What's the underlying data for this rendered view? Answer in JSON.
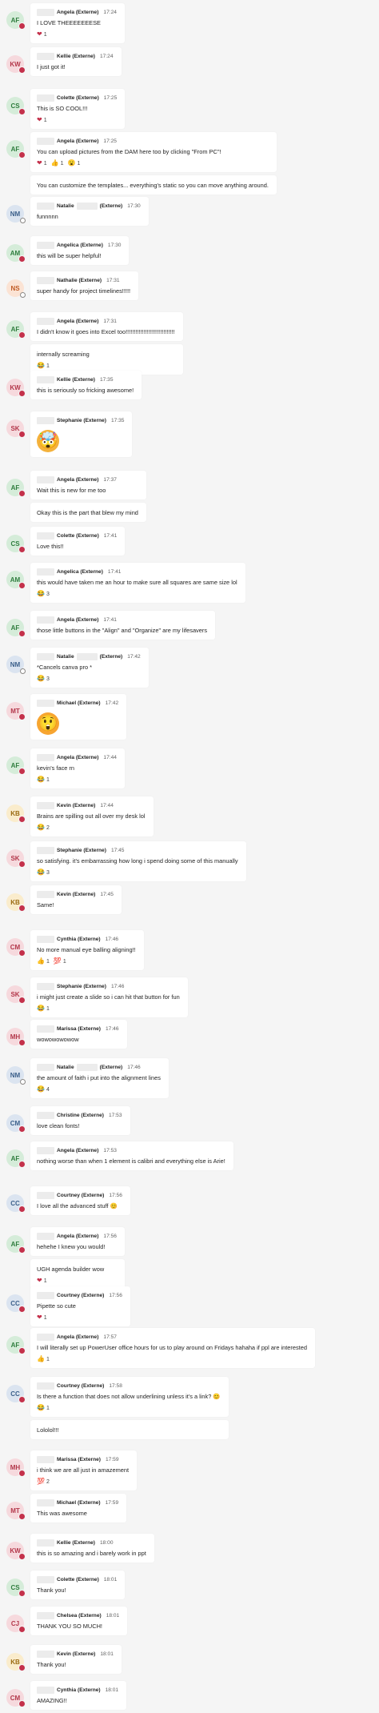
{
  "messages": [
    {
      "initials": "AF",
      "avatar_bg": "#d5ecd9",
      "avatar_fg": "#2f7d3e",
      "presence": "busy",
      "name_prefix_hidden": true,
      "name": "Angela (Externe)",
      "time": "17:24",
      "parts": [
        {
          "text": "I LOVE THEEEEEEESE",
          "reactions": [
            {
              "emoji": "❤",
              "color": "#c4314b",
              "count": "1"
            }
          ]
        }
      ]
    },
    {
      "initials": "KW",
      "avatar_bg": "#f6d9dd",
      "avatar_fg": "#b3374a",
      "presence": "busy",
      "name": "Kellie (Externe)",
      "time": "17:24",
      "parts": [
        {
          "text": "I just got it!",
          "reactions": []
        }
      ]
    },
    {
      "initials": "CS",
      "avatar_bg": "#d5ecd9",
      "avatar_fg": "#2f7d3e",
      "presence": "busy",
      "name": "Colette (Externe)",
      "time": "17:25",
      "parts": [
        {
          "text": "This is SO COOL!!!",
          "reactions": [
            {
              "emoji": "❤",
              "color": "#c4314b",
              "count": "1"
            }
          ]
        }
      ]
    },
    {
      "initials": "AF",
      "avatar_bg": "#d5ecd9",
      "avatar_fg": "#2f7d3e",
      "presence": "busy",
      "name": "Angela (Externe)",
      "time": "17:25",
      "parts": [
        {
          "text": "You can upload pictures from the DAM here too by clicking \"From PC\"!",
          "reactions": [
            {
              "emoji": "❤",
              "color": "#c4314b",
              "count": "1"
            },
            {
              "emoji": "👍",
              "color": "#e8a33a",
              "count": "1"
            },
            {
              "emoji": "😮",
              "color": "#e8a33a",
              "count": "1"
            }
          ]
        },
        {
          "text": "You can customize the templates... everything's static so you can move anything around.",
          "reactions": []
        }
      ]
    },
    {
      "initials": "NM",
      "avatar_bg": "#dbe4f0",
      "avatar_fg": "#3b5f8a",
      "presence": "away",
      "name": "Natalie",
      "name_mid_hidden": true,
      "name_suffix": "(Externe)",
      "time": "17:30",
      "parts": [
        {
          "text": "funnnnn",
          "reactions": []
        }
      ]
    },
    {
      "initials": "AM",
      "avatar_bg": "#d5ecd9",
      "avatar_fg": "#2f7d3e",
      "presence": "busy",
      "name": "Angelica (Externe)",
      "time": "17:30",
      "parts": [
        {
          "text": "this will be super helpful!",
          "reactions": []
        }
      ]
    },
    {
      "initials": "NS",
      "avatar_bg": "#fbe3d4",
      "avatar_fg": "#c05a23",
      "presence": "away",
      "name": "Nathalie (Externe)",
      "time": "17:31",
      "parts": [
        {
          "text": "super handy for project timelines!!!!!",
          "reactions": []
        }
      ]
    },
    {
      "initials": "AF",
      "avatar_bg": "#d5ecd9",
      "avatar_fg": "#2f7d3e",
      "presence": "busy",
      "name": "Angela (Externe)",
      "time": "17:31",
      "parts": [
        {
          "text": "I didn't know it goes into Excel too!!!!!!!!!!!!!!!!!!!!!!!!!!!!!!",
          "reactions": []
        },
        {
          "text": "internally screaming",
          "reactions": [
            {
              "emoji": "😂",
              "color": "#e8a33a",
              "count": "1"
            }
          ]
        }
      ]
    },
    {
      "initials": "KW",
      "avatar_bg": "#f6d9dd",
      "avatar_fg": "#b3374a",
      "presence": "busy",
      "name": "Kellie (Externe)",
      "time": "17:35",
      "parts": [
        {
          "text": "this is seriously so fricking awesome!",
          "reactions": []
        }
      ]
    },
    {
      "initials": "SK",
      "avatar_bg": "#f6d9dd",
      "avatar_fg": "#b3374a",
      "presence": "busy",
      "name": "Stephanie (Externe)",
      "time": "17:35",
      "parts": [
        {
          "sticker": "🤯",
          "sticker_style": "mind-blown",
          "reactions": []
        }
      ]
    },
    {
      "initials": "AF",
      "avatar_bg": "#d5ecd9",
      "avatar_fg": "#2f7d3e",
      "presence": "busy",
      "name": "Angela (Externe)",
      "time": "17:37",
      "parts": [
        {
          "text": "Wait this is new for me too",
          "reactions": []
        },
        {
          "text": "Okay this is the part that blew my mind",
          "reactions": []
        }
      ]
    },
    {
      "initials": "CS",
      "avatar_bg": "#d5ecd9",
      "avatar_fg": "#2f7d3e",
      "presence": "busy",
      "name": "Colette (Externe)",
      "time": "17:41",
      "parts": [
        {
          "text": "Love this!!",
          "reactions": []
        }
      ]
    },
    {
      "initials": "AM",
      "avatar_bg": "#d5ecd9",
      "avatar_fg": "#2f7d3e",
      "presence": "busy",
      "name": "Angelica (Externe)",
      "time": "17:41",
      "parts": [
        {
          "text": "this would have taken me an hour to make sure all squares are same size lol",
          "reactions": [
            {
              "emoji": "😂",
              "color": "#e8a33a",
              "count": "3"
            }
          ]
        }
      ]
    },
    {
      "initials": "AF",
      "avatar_bg": "#d5ecd9",
      "avatar_fg": "#2f7d3e",
      "presence": "busy",
      "name": "Angela (Externe)",
      "time": "17:41",
      "parts": [
        {
          "text": "those little buttons in the \"Align\" and \"Organize\" are my lifesavers",
          "reactions": []
        }
      ]
    },
    {
      "initials": "NM",
      "avatar_bg": "#dbe4f0",
      "avatar_fg": "#3b5f8a",
      "presence": "away",
      "name": "Natalie",
      "name_mid_hidden": true,
      "name_suffix": "(Externe)",
      "time": "17:42",
      "parts": [
        {
          "text": "*Cancels canva pro *",
          "reactions": [
            {
              "emoji": "😂",
              "color": "#e8a33a",
              "count": "3"
            }
          ]
        }
      ]
    },
    {
      "initials": "MT",
      "avatar_bg": "#f6d9dd",
      "avatar_fg": "#b3374a",
      "presence": "busy",
      "name": "Michael (Externe)",
      "time": "17:42",
      "parts": [
        {
          "sticker": "😲",
          "sticker_style": "shock",
          "reactions": []
        }
      ]
    },
    {
      "initials": "AF",
      "avatar_bg": "#d5ecd9",
      "avatar_fg": "#2f7d3e",
      "presence": "busy",
      "name": "Angela (Externe)",
      "time": "17:44",
      "parts": [
        {
          "text": "kevin's face rn",
          "reactions": [
            {
              "emoji": "😂",
              "color": "#e8a33a",
              "count": "1"
            }
          ]
        }
      ]
    },
    {
      "initials": "KB",
      "avatar_bg": "#faeccc",
      "avatar_fg": "#9a6a12",
      "presence": "busy",
      "name": "Kevin (Externe)",
      "time": "17:44",
      "parts": [
        {
          "text": "Brains are spilling out all over my desk lol",
          "reactions": [
            {
              "emoji": "😂",
              "color": "#e8a33a",
              "count": "2"
            }
          ]
        }
      ]
    },
    {
      "initials": "SK",
      "avatar_bg": "#f6d9dd",
      "avatar_fg": "#b3374a",
      "presence": "busy",
      "name": "Stephanie (Externe)",
      "time": "17:45",
      "parts": [
        {
          "text": "so satisfying. it's embarrassing how long i spend doing some of this manually",
          "reactions": [
            {
              "emoji": "😂",
              "color": "#e8a33a",
              "count": "3"
            }
          ]
        }
      ]
    },
    {
      "initials": "KB",
      "avatar_bg": "#faeccc",
      "avatar_fg": "#9a6a12",
      "presence": "busy",
      "name": "Kevin (Externe)",
      "time": "17:45",
      "parts": [
        {
          "text": "Same!",
          "reactions": []
        }
      ]
    },
    {
      "initials": "CM",
      "avatar_bg": "#f6d9dd",
      "avatar_fg": "#b3374a",
      "presence": "busy",
      "name": "Cynthia (Externe)",
      "time": "17:46",
      "parts": [
        {
          "text": "No more manual eye balling aligning!!",
          "reactions": [
            {
              "emoji": "👍",
              "color": "#e8a33a",
              "count": "1"
            },
            {
              "emoji": "💯",
              "color": "#c4314b",
              "count": "1"
            }
          ]
        }
      ]
    },
    {
      "initials": "SK",
      "avatar_bg": "#f6d9dd",
      "avatar_fg": "#b3374a",
      "presence": "busy",
      "name": "Stephanie (Externe)",
      "time": "17:46",
      "parts": [
        {
          "text": "i might just create a slide so i can hit that button for fun",
          "reactions": [
            {
              "emoji": "😂",
              "color": "#e8a33a",
              "count": "1"
            }
          ]
        }
      ]
    },
    {
      "initials": "MH",
      "avatar_bg": "#f6d9dd",
      "avatar_fg": "#b3374a",
      "presence": "busy",
      "name": "Marissa (Externe)",
      "time": "17:46",
      "parts": [
        {
          "text": "wowowowowow",
          "reactions": []
        }
      ]
    },
    {
      "initials": "NM",
      "avatar_bg": "#dbe4f0",
      "avatar_fg": "#3b5f8a",
      "presence": "away",
      "name": "Natalie",
      "name_mid_hidden": true,
      "name_suffix": "(Externe)",
      "time": "17:46",
      "parts": [
        {
          "text": "the amount of faith i put into the alignment lines",
          "reactions": [
            {
              "emoji": "😂",
              "color": "#e8a33a",
              "count": "4"
            }
          ]
        }
      ]
    },
    {
      "initials": "CM",
      "avatar_bg": "#dbe4f0",
      "avatar_fg": "#3b5f8a",
      "presence": "busy",
      "name": "Christine (Externe)",
      "time": "17:53",
      "parts": [
        {
          "text": "love clean fonts!",
          "reactions": []
        }
      ]
    },
    {
      "initials": "AF",
      "avatar_bg": "#d5ecd9",
      "avatar_fg": "#2f7d3e",
      "presence": "busy",
      "name": "Angela (Externe)",
      "time": "17:53",
      "parts": [
        {
          "text": "nothing worse than when 1 element is calibri and everything else is Arie!",
          "reactions": []
        }
      ]
    },
    {
      "initials": "CC",
      "avatar_bg": "#dbe4f0",
      "avatar_fg": "#3b5f8a",
      "presence": "busy",
      "name": "Courtney (Externe)",
      "time": "17:56",
      "parts": [
        {
          "text": "I love all the advanced stuff 😊",
          "reactions": []
        }
      ]
    },
    {
      "initials": "AF",
      "avatar_bg": "#d5ecd9",
      "avatar_fg": "#2f7d3e",
      "presence": "busy",
      "name": "Angela (Externe)",
      "time": "17:56",
      "parts": [
        {
          "text": "hehehe I knew you would!",
          "reactions": []
        },
        {
          "text": "UGH agenda builder wow",
          "reactions": [
            {
              "emoji": "❤",
              "color": "#c4314b",
              "count": "1"
            }
          ]
        }
      ]
    },
    {
      "initials": "CC",
      "avatar_bg": "#dbe4f0",
      "avatar_fg": "#3b5f8a",
      "presence": "busy",
      "name": "Courtney (Externe)",
      "time": "17:56",
      "parts": [
        {
          "text": "Pipette so cute",
          "reactions": [
            {
              "emoji": "❤",
              "color": "#c4314b",
              "count": "1"
            }
          ]
        }
      ]
    },
    {
      "initials": "AF",
      "avatar_bg": "#d5ecd9",
      "avatar_fg": "#2f7d3e",
      "presence": "busy",
      "name": "Angela (Externe)",
      "time": "17:57",
      "parts": [
        {
          "text": "I will literally set up PowerUser office hours for us to play around on Fridays hahaha if ppl are interested",
          "reactions": [
            {
              "emoji": "👍",
              "color": "#e8a33a",
              "count": "1"
            }
          ]
        }
      ]
    },
    {
      "initials": "CC",
      "avatar_bg": "#dbe4f0",
      "avatar_fg": "#3b5f8a",
      "presence": "busy",
      "name": "Courtney (Externe)",
      "time": "17:58",
      "parts": [
        {
          "text": "Is there a function that does not allow underlining unless it's a link? 😊",
          "reactions": [
            {
              "emoji": "😂",
              "color": "#e8a33a",
              "count": "1"
            }
          ]
        },
        {
          "text": "Lololol!!!",
          "reactions": []
        }
      ]
    },
    {
      "initials": "MH",
      "avatar_bg": "#f6d9dd",
      "avatar_fg": "#b3374a",
      "presence": "busy",
      "name": "Marissa (Externe)",
      "time": "17:59",
      "parts": [
        {
          "text": "i think we are all just in amazement",
          "reactions": [
            {
              "emoji": "💯",
              "color": "#c4314b",
              "count": "2"
            }
          ]
        }
      ]
    },
    {
      "initials": "MT",
      "avatar_bg": "#f6d9dd",
      "avatar_fg": "#b3374a",
      "presence": "busy",
      "name": "Michael (Externe)",
      "time": "17:59",
      "parts": [
        {
          "text": "This was awesome",
          "reactions": []
        }
      ]
    },
    {
      "initials": "KW",
      "avatar_bg": "#f6d9dd",
      "avatar_fg": "#b3374a",
      "presence": "busy",
      "name": "Kellie (Externe)",
      "time": "18:00",
      "parts": [
        {
          "text": "this is so amazing and i barely work in ppt",
          "reactions": []
        }
      ]
    },
    {
      "initials": "CS",
      "avatar_bg": "#d5ecd9",
      "avatar_fg": "#2f7d3e",
      "presence": "busy",
      "name": "Colette (Externe)",
      "time": "18:01",
      "parts": [
        {
          "text": "Thank you!",
          "reactions": []
        }
      ]
    },
    {
      "initials": "CJ",
      "avatar_bg": "#f6d9dd",
      "avatar_fg": "#b3374a",
      "presence": "busy",
      "name": "Chelsea (Externe)",
      "time": "18:01",
      "parts": [
        {
          "text": "THANK YOU SO MUCH!",
          "reactions": []
        }
      ]
    },
    {
      "initials": "KB",
      "avatar_bg": "#faeccc",
      "avatar_fg": "#9a6a12",
      "presence": "busy",
      "name": "Kevin (Externe)",
      "time": "18:01",
      "parts": [
        {
          "text": "Thank you!",
          "reactions": []
        }
      ]
    },
    {
      "initials": "CM",
      "avatar_bg": "#f6d9dd",
      "avatar_fg": "#b3374a",
      "presence": "busy",
      "name": "Cynthia (Externe)",
      "time": "18:01",
      "parts": [
        {
          "text": "AMAZING!!",
          "reactions": []
        }
      ]
    }
  ]
}
